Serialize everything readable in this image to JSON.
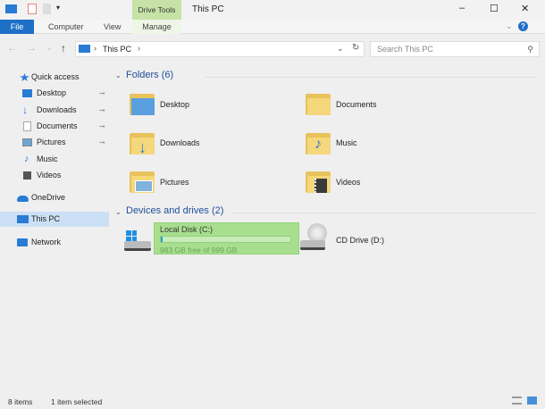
{
  "window": {
    "title": "This PC",
    "context_tab": "Drive Tools",
    "minimize": "–",
    "maximize": "☐",
    "close": "✕"
  },
  "ribbon": {
    "tabs": [
      "File",
      "Computer",
      "View",
      "Manage"
    ],
    "help": "?",
    "collapse": "⌄"
  },
  "address": {
    "back": "←",
    "forward": "→",
    "recent": "⌄",
    "up": "↑",
    "path": "This PC",
    "sep": "›",
    "dropdown": "⌄",
    "refresh": "↻",
    "search_placeholder": "Search This PC",
    "search_icon": "⚲"
  },
  "nav": {
    "items": [
      {
        "label": "Quick access",
        "icon": "star-icon",
        "color": "#2a7bd4"
      },
      {
        "label": "Desktop",
        "icon": "desktop-icon",
        "color": "#2a7bd4",
        "pin": true
      },
      {
        "label": "Downloads",
        "icon": "download-icon",
        "color": "#2a7bd4",
        "pin": true
      },
      {
        "label": "Documents",
        "icon": "documents-icon",
        "color": "#ccc",
        "pin": true
      },
      {
        "label": "Pictures",
        "icon": "pictures-icon",
        "color": "#6aa6d6",
        "pin": true
      },
      {
        "label": "Music",
        "icon": "music-icon",
        "color": "#2a7bd4"
      },
      {
        "label": "Videos",
        "icon": "videos-icon",
        "color": "#555"
      },
      {
        "label": "OneDrive",
        "icon": "cloud-icon",
        "color": "#2a7bd4"
      },
      {
        "label": "This PC",
        "icon": "computer-icon",
        "color": "#2a7bd4",
        "selected": true
      },
      {
        "label": "Network",
        "icon": "network-icon",
        "color": "#2a7bd4"
      }
    ],
    "pin_glyph": "📌"
  },
  "folders": {
    "header": "Folders (6)",
    "items": [
      "Desktop",
      "Documents",
      "Downloads",
      "Music",
      "Pictures",
      "Videos"
    ]
  },
  "devices": {
    "header": "Devices and drives (2)",
    "drives": [
      {
        "name": "Local Disk (C:)",
        "free": "983 GB free of 999 GB",
        "used_fraction": 0.016,
        "selected": true
      },
      {
        "name": "CD Drive (D:)"
      }
    ]
  },
  "status": {
    "count": "8 items",
    "selected": "1 item selected"
  }
}
